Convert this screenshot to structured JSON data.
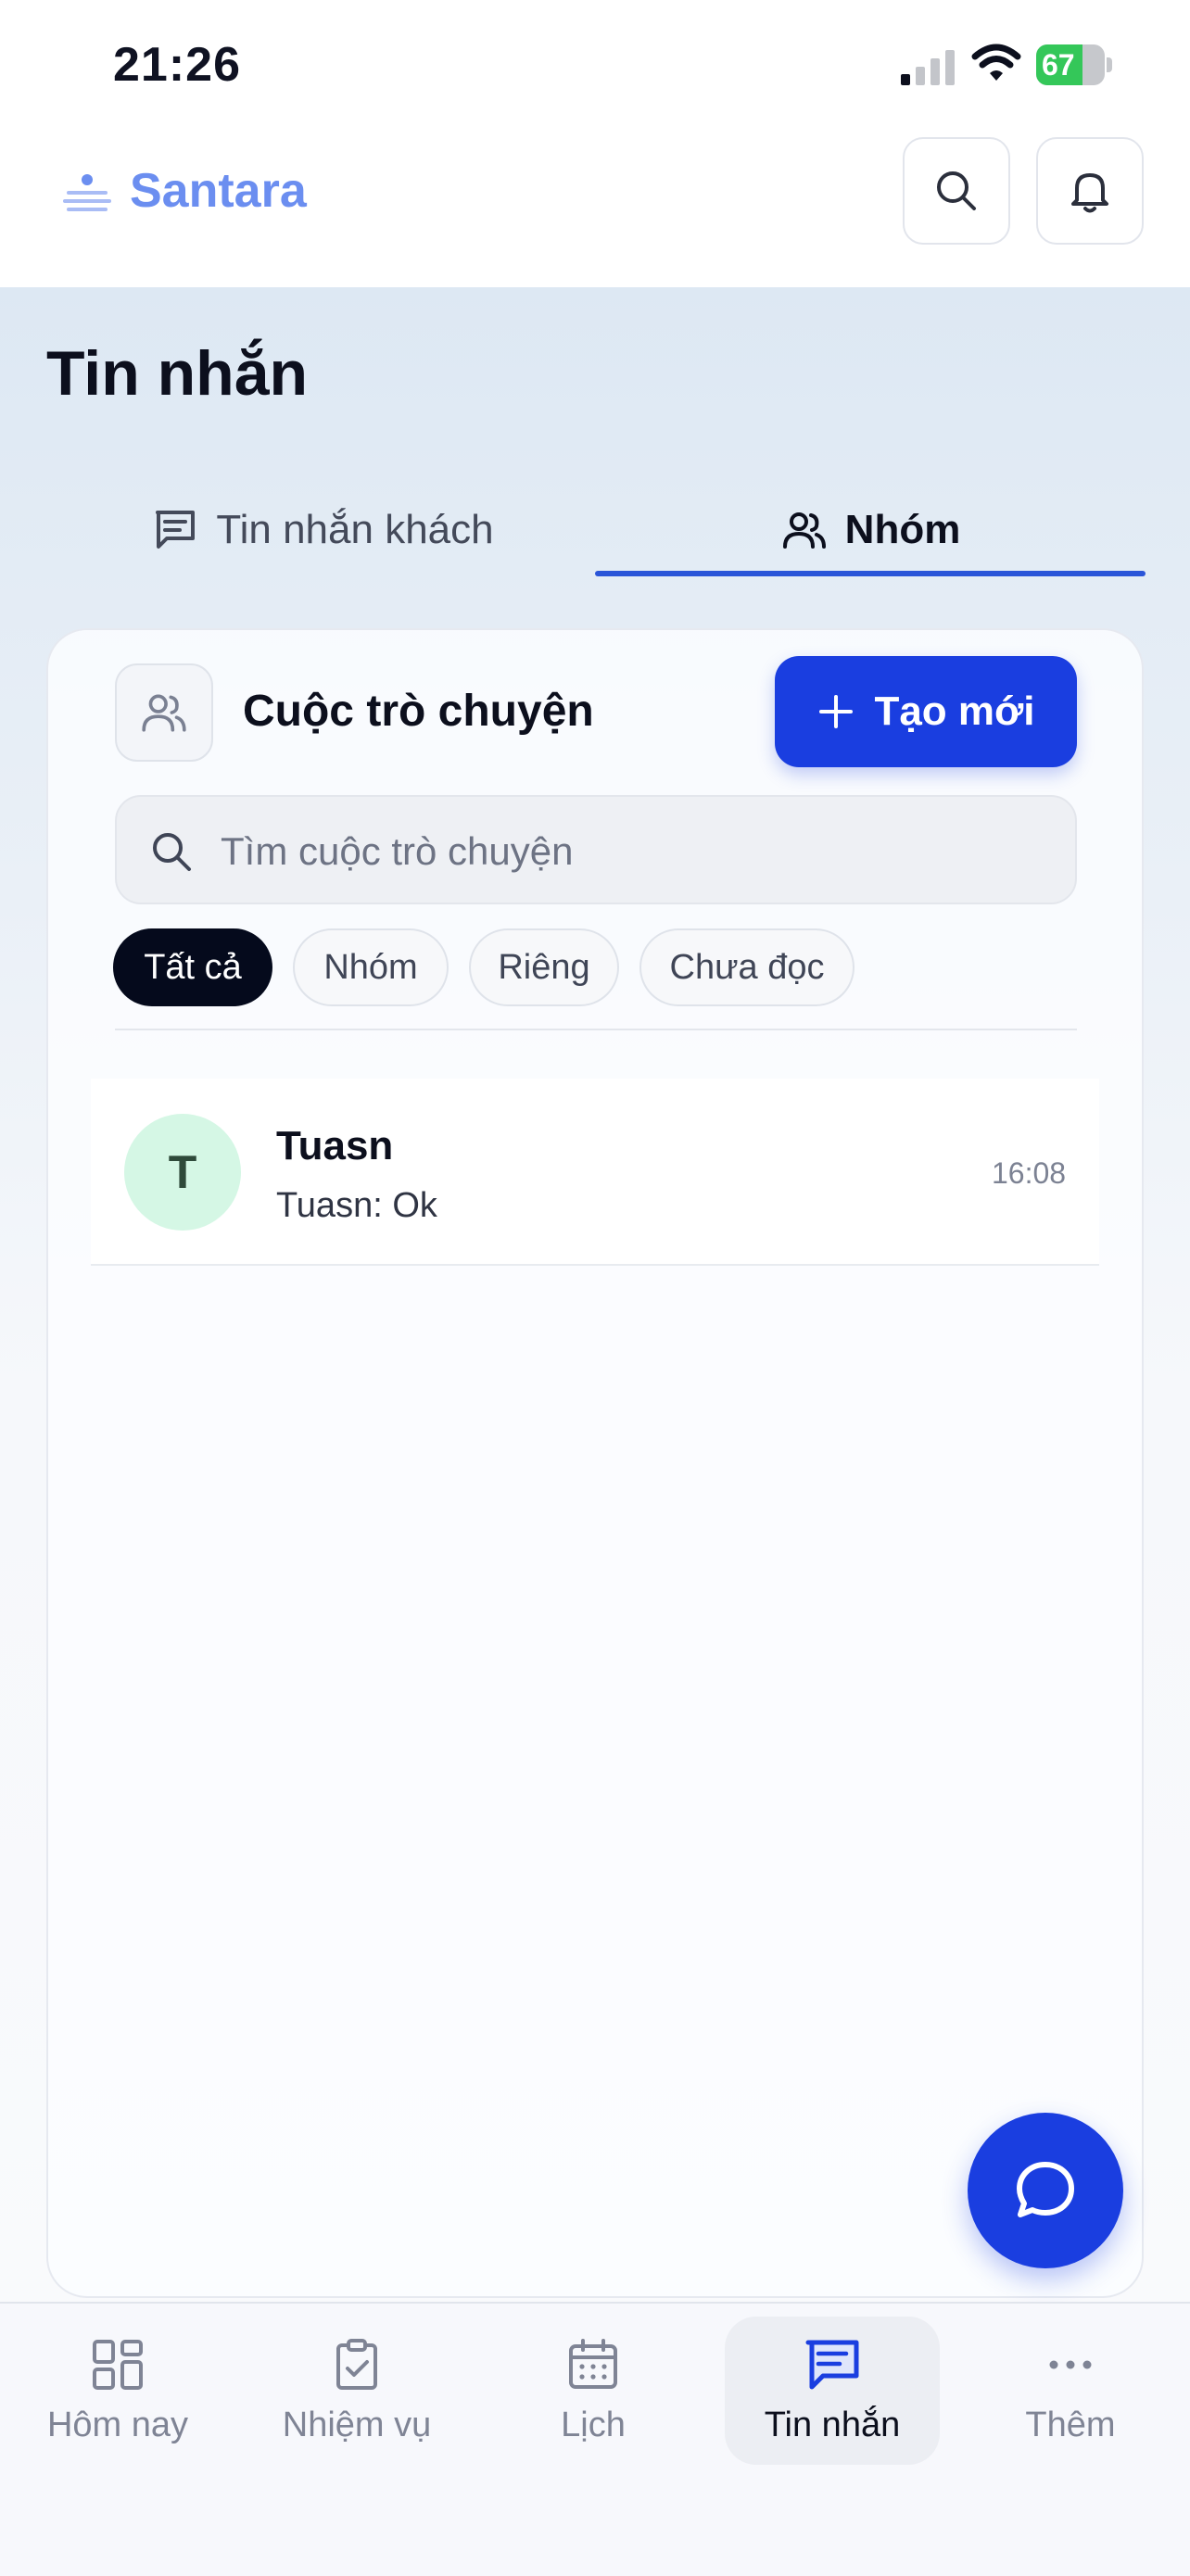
{
  "status_bar": {
    "time": "21:26",
    "battery": "67",
    "battery_level": 67
  },
  "header": {
    "brand": "Santara",
    "search_icon": "search-icon",
    "bell_icon": "bell-icon"
  },
  "page": {
    "title": "Tin nhắn"
  },
  "tabs": [
    {
      "label": "Tin nhắn khách",
      "icon": "message-lines-icon",
      "active": false
    },
    {
      "label": "Nhóm",
      "icon": "users-icon",
      "active": true
    }
  ],
  "panel": {
    "title": "Cuộc trò chuyện",
    "create_label": "Tạo mới",
    "search_placeholder": "Tìm cuộc trò chuyện",
    "filters": [
      "Tất cả",
      "Nhóm",
      "Riêng",
      "Chưa đọc"
    ],
    "active_filter": "Tất cả"
  },
  "conversations": [
    {
      "initial": "T",
      "name": "Tuasn",
      "preview": "Tuasn: Ok",
      "time": "16:08",
      "avatar_color": "#d5f7e5"
    }
  ],
  "bottom_nav": [
    {
      "label": "Hôm nay",
      "icon": "grid-icon",
      "active": false
    },
    {
      "label": "Nhiệm vụ",
      "icon": "clipboard-check-icon",
      "active": false
    },
    {
      "label": "Lịch",
      "icon": "calendar-icon",
      "active": false
    },
    {
      "label": "Tin nhắn",
      "icon": "message-icon",
      "active": true
    },
    {
      "label": "Thêm",
      "icon": "more-dots-icon",
      "active": false
    }
  ],
  "colors": {
    "accent": "#1a3ee0",
    "brand": "#6b8ef0",
    "active_chip": "#050a1c",
    "tab_underline": "#2a55d8"
  }
}
